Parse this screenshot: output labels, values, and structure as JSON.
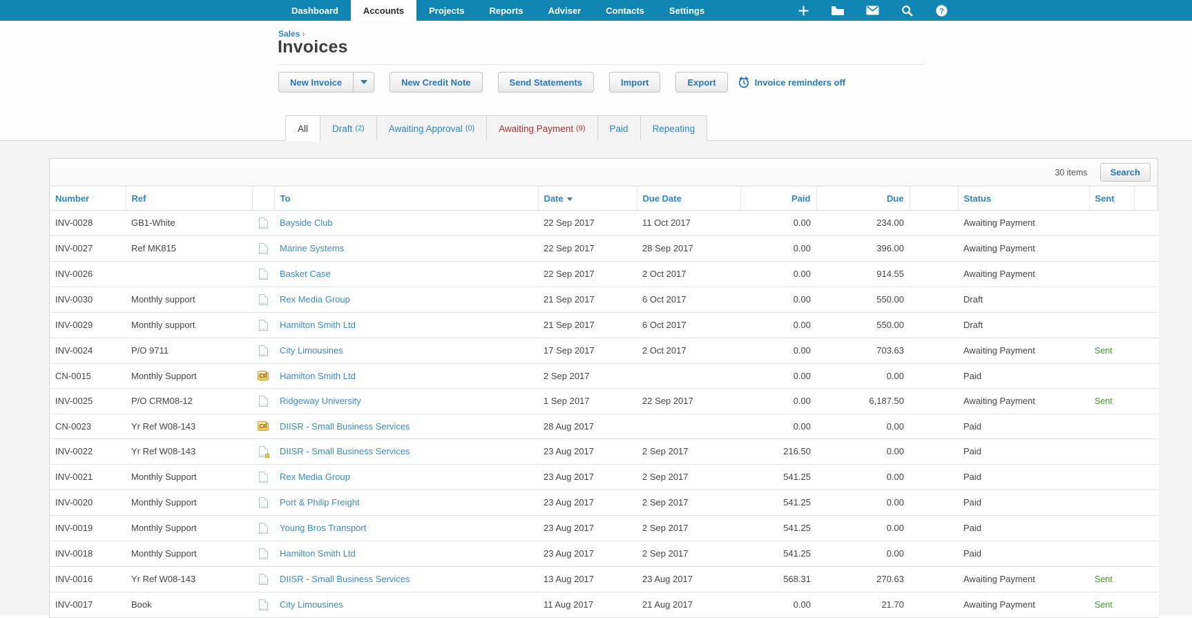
{
  "colors": {
    "nav_blue": "#1286b2",
    "link_blue": "#2e86c1",
    "alert_red": "#a5352c",
    "sent_green": "#3d9b23"
  },
  "nav": {
    "items": [
      {
        "label": "Dashboard",
        "active": false
      },
      {
        "label": "Accounts",
        "active": true
      },
      {
        "label": "Projects",
        "active": false
      },
      {
        "label": "Reports",
        "active": false
      },
      {
        "label": "Adviser",
        "active": false
      },
      {
        "label": "Contacts",
        "active": false
      },
      {
        "label": "Settings",
        "active": false
      }
    ],
    "icons": [
      "plus-icon",
      "folder-icon",
      "mail-icon",
      "search-icon",
      "help-icon"
    ]
  },
  "breadcrumb": {
    "label": "Sales",
    "arrow": "›"
  },
  "page_title": "Invoices",
  "actions": {
    "new_invoice": "New Invoice",
    "new_credit_note": "New Credit Note",
    "send_statements": "Send Statements",
    "import": "Import",
    "export": "Export",
    "reminders": "Invoice reminders off"
  },
  "tabs": [
    {
      "label": "All",
      "count": "",
      "active": true,
      "red": false
    },
    {
      "label": "Draft",
      "count": "(2)",
      "active": false,
      "red": false
    },
    {
      "label": "Awaiting Approval",
      "count": "(0)",
      "active": false,
      "red": false
    },
    {
      "label": "Awaiting Payment",
      "count": "(9)",
      "active": false,
      "red": true
    },
    {
      "label": "Paid",
      "count": "",
      "active": false,
      "red": false
    },
    {
      "label": "Repeating",
      "count": "",
      "active": false,
      "red": false
    }
  ],
  "table": {
    "items_count": "30 items",
    "search_label": "Search",
    "columns": [
      {
        "label": "Number"
      },
      {
        "label": "Ref"
      },
      {
        "label": ""
      },
      {
        "label": "To"
      },
      {
        "label": "Date",
        "sorted": "desc"
      },
      {
        "label": "Due Date"
      },
      {
        "label": "Paid",
        "align": "right"
      },
      {
        "label": "Due",
        "align": "right"
      },
      {
        "label": ""
      },
      {
        "label": "Status"
      },
      {
        "label": "Sent"
      },
      {
        "label": ""
      }
    ],
    "rows": [
      {
        "number": "INV-0028",
        "ref": "GB1-White",
        "icon": "document-icon",
        "to": "Bayside Club",
        "date": "22 Sep 2017",
        "due_date": "11 Oct 2017",
        "paid": "0.00",
        "due": "234.00",
        "status": "Awaiting Payment",
        "sent": ""
      },
      {
        "number": "INV-0027",
        "ref": "Ref MK815",
        "icon": "document-icon",
        "to": "Marine Systems",
        "date": "22 Sep 2017",
        "due_date": "28 Sep 2017",
        "paid": "0.00",
        "due": "396.00",
        "status": "Awaiting Payment",
        "sent": ""
      },
      {
        "number": "INV-0026",
        "ref": "",
        "icon": "document-icon",
        "to": "Basket Case",
        "date": "22 Sep 2017",
        "due_date": "2 Oct 2017",
        "paid": "0.00",
        "due": "914.55",
        "status": "Awaiting Payment",
        "sent": ""
      },
      {
        "number": "INV-0030",
        "ref": "Monthly support",
        "icon": "document-icon",
        "to": "Rex Media Group",
        "date": "21 Sep 2017",
        "due_date": "6 Oct 2017",
        "paid": "0.00",
        "due": "550.00",
        "status": "Draft",
        "sent": ""
      },
      {
        "number": "INV-0029",
        "ref": "Monthly support",
        "icon": "document-icon",
        "to": "Hamilton Smith Ltd",
        "date": "21 Sep 2017",
        "due_date": "6 Oct 2017",
        "paid": "0.00",
        "due": "550.00",
        "status": "Draft",
        "sent": ""
      },
      {
        "number": "INV-0024",
        "ref": "P/O 9711",
        "icon": "document-icon",
        "to": "City Limousines",
        "date": "17 Sep 2017",
        "due_date": "2 Oct 2017",
        "paid": "0.00",
        "due": "703.63",
        "status": "Awaiting Payment",
        "sent": "Sent"
      },
      {
        "number": "CN-0015",
        "ref": "Monthly Support",
        "icon": "credit-note-icon",
        "to": "Hamilton Smith Ltd",
        "date": "2 Sep 2017",
        "due_date": "",
        "paid": "0.00",
        "due": "0.00",
        "status": "Paid",
        "sent": ""
      },
      {
        "number": "INV-0025",
        "ref": "P/O CRM08-12",
        "icon": "document-icon",
        "to": "Ridgeway University",
        "date": "1 Sep 2017",
        "due_date": "22 Sep 2017",
        "paid": "0.00",
        "due": "6,187.50",
        "status": "Awaiting Payment",
        "sent": "Sent"
      },
      {
        "number": "CN-0023",
        "ref": "Yr Ref W08-143",
        "icon": "credit-note-icon",
        "to": "DIISR - Small Business Services",
        "date": "28 Aug 2017",
        "due_date": "",
        "paid": "0.00",
        "due": "0.00",
        "status": "Paid",
        "sent": ""
      },
      {
        "number": "INV-0022",
        "ref": "Yr Ref W08-143",
        "icon": "document-credit-icon",
        "to": "DIISR - Small Business Services",
        "date": "23 Aug 2017",
        "due_date": "2 Sep 2017",
        "paid": "216.50",
        "due": "0.00",
        "status": "Paid",
        "sent": ""
      },
      {
        "number": "INV-0021",
        "ref": "Monthly Support",
        "icon": "document-icon",
        "to": "Rex Media Group",
        "date": "23 Aug 2017",
        "due_date": "2 Sep 2017",
        "paid": "541.25",
        "due": "0.00",
        "status": "Paid",
        "sent": ""
      },
      {
        "number": "INV-0020",
        "ref": "Monthly Support",
        "icon": "document-icon",
        "to": "Port & Philip Freight",
        "date": "23 Aug 2017",
        "due_date": "2 Sep 2017",
        "paid": "541.25",
        "due": "0.00",
        "status": "Paid",
        "sent": ""
      },
      {
        "number": "INV-0019",
        "ref": "Monthly Support",
        "icon": "document-icon",
        "to": "Young Bros Transport",
        "date": "23 Aug 2017",
        "due_date": "2 Sep 2017",
        "paid": "541.25",
        "due": "0.00",
        "status": "Paid",
        "sent": ""
      },
      {
        "number": "INV-0018",
        "ref": "Monthly Support",
        "icon": "document-icon",
        "to": "Hamilton Smith Ltd",
        "date": "23 Aug 2017",
        "due_date": "2 Sep 2017",
        "paid": "541.25",
        "due": "0.00",
        "status": "Paid",
        "sent": ""
      },
      {
        "number": "INV-0016",
        "ref": "Yr Ref W08-143",
        "icon": "document-icon",
        "to": "DIISR - Small Business Services",
        "date": "13 Aug 2017",
        "due_date": "23 Aug 2017",
        "paid": "568.31",
        "due": "270.63",
        "status": "Awaiting Payment",
        "sent": "Sent"
      },
      {
        "number": "INV-0017",
        "ref": "Book",
        "icon": "document-icon",
        "to": "City Limousines",
        "date": "11 Aug 2017",
        "due_date": "21 Aug 2017",
        "paid": "0.00",
        "due": "21.70",
        "status": "Awaiting Payment",
        "sent": "Sent"
      }
    ]
  }
}
